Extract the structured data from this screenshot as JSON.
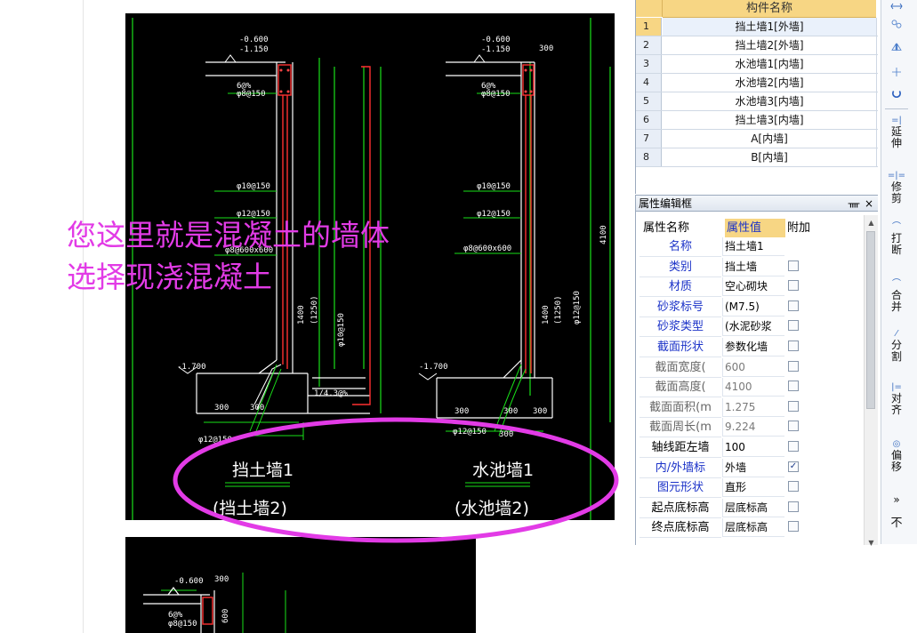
{
  "overlay": {
    "line1": "您这里就是混凝土的墙体",
    "line2": "选择现浇混凝土"
  },
  "drawing": {
    "left_title": "挡土墙1",
    "left_subtitle": "(挡土墙2)",
    "right_title": "水池墙1",
    "right_subtitle": "(水池墙2)",
    "left_labels": [
      "-0.600",
      "-1.150",
      "6@%",
      "φ8@150",
      "φ10@150",
      "φ12@150",
      "φ8@600x600",
      "1400",
      "(1250)",
      "φ10@150",
      "-1.700",
      "300",
      "300",
      "φ12@150",
      "1/4.3@%"
    ],
    "right_labels": [
      "-0.600",
      "-1.150",
      "300",
      "6@%",
      "φ8@150",
      "φ10@150",
      "φ12@150",
      "φ8@600x600",
      "1400",
      "(1250)",
      "4100",
      "φ12@150",
      "-1.700",
      "300",
      "300",
      "300",
      "φ12@150",
      "300"
    ],
    "bottom_labels": [
      "-0.600",
      "300",
      "6@%",
      "φ8@150",
      "600"
    ]
  },
  "component_list": {
    "header": "构件名称",
    "rows": [
      {
        "index": "1",
        "name": "挡土墙1[外墙]"
      },
      {
        "index": "2",
        "name": "挡土墙2[外墙]"
      },
      {
        "index": "3",
        "name": "水池墙1[内墙]"
      },
      {
        "index": "4",
        "name": "水池墙2[内墙]"
      },
      {
        "index": "5",
        "name": "水池墙3[内墙]"
      },
      {
        "index": "6",
        "name": "挡土墙3[内墙]"
      },
      {
        "index": "7",
        "name": "A[内墙]"
      },
      {
        "index": "8",
        "name": "B[内墙]"
      }
    ],
    "selected_index": "1"
  },
  "properties": {
    "panel_title": "属性编辑框",
    "pin_icon": "pin-icon",
    "close_icon": "close-icon",
    "col_name": "属性名称",
    "col_value": "属性值",
    "col_extra": "附加",
    "rows": [
      {
        "name": "名称",
        "value": "挡土墙1",
        "checkbox": false,
        "checked": false,
        "style": "blue"
      },
      {
        "name": "类别",
        "value": "挡土墙",
        "checkbox": true,
        "checked": false,
        "style": "blue"
      },
      {
        "name": "材质",
        "value": "空心砌块",
        "checkbox": true,
        "checked": false,
        "style": "blue"
      },
      {
        "name": "砂浆标号",
        "value": "(M7.5)",
        "checkbox": true,
        "checked": false,
        "style": "blue"
      },
      {
        "name": "砂浆类型",
        "value": "(水泥砂浆",
        "checkbox": true,
        "checked": false,
        "style": "blue"
      },
      {
        "name": "截面形状",
        "value": "参数化墙",
        "checkbox": true,
        "checked": false,
        "style": "blue"
      },
      {
        "name": "截面宽度(",
        "value": "600",
        "checkbox": true,
        "checked": false,
        "style": "gray"
      },
      {
        "name": "截面高度(",
        "value": "4100",
        "checkbox": true,
        "checked": false,
        "style": "gray"
      },
      {
        "name": "截面面积(m",
        "value": "1.275",
        "checkbox": true,
        "checked": false,
        "style": "gray"
      },
      {
        "name": "截面周长(m",
        "value": "9.224",
        "checkbox": true,
        "checked": false,
        "style": "gray"
      },
      {
        "name": "轴线距左墙",
        "value": "100",
        "checkbox": true,
        "checked": false,
        "style": "black"
      },
      {
        "name": "内/外墙标",
        "value": "外墙",
        "checkbox": true,
        "checked": true,
        "style": "blue"
      },
      {
        "name": "图元形状",
        "value": "直形",
        "checkbox": true,
        "checked": false,
        "style": "blue"
      },
      {
        "name": "起点底标高",
        "value": "层底标高",
        "checkbox": true,
        "checked": false,
        "style": "black"
      },
      {
        "name": "终点底标高",
        "value": "层底标高",
        "checkbox": true,
        "checked": false,
        "style": "black"
      }
    ]
  },
  "toolbar": {
    "items": [
      {
        "label": "延伸",
        "icon": "extend-icon"
      },
      {
        "label": "修剪",
        "icon": "trim-icon"
      },
      {
        "label": "打断",
        "icon": "break-icon"
      },
      {
        "label": "合并",
        "icon": "merge-icon"
      },
      {
        "label": "分割",
        "icon": "split-icon"
      },
      {
        "label": "对齐",
        "icon": "align-icon"
      },
      {
        "label": "偏移",
        "icon": "offset-icon"
      }
    ],
    "bottom_text": "不"
  },
  "colors": {
    "overlay": "#e23be6",
    "ellipse": "#e23be6",
    "cad_background": "#000000",
    "selected_header": "#f7d684"
  }
}
